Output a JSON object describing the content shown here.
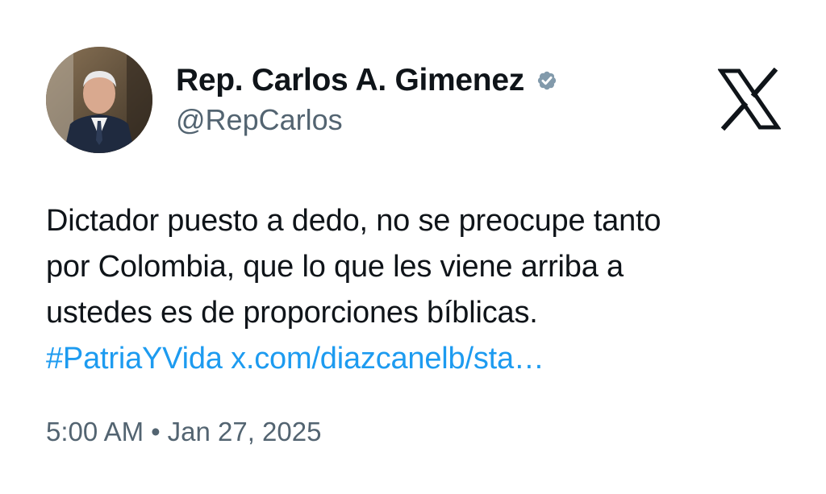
{
  "author": {
    "display_name": "Rep. Carlos A. Gimenez",
    "handle": "@RepCarlos",
    "verified_icon": "verified-badge-icon",
    "avatar": "profile-photo"
  },
  "brand": {
    "logo": "x-logo-icon"
  },
  "tweet": {
    "lines": [
      "Dictador puesto a dedo, no se preocupe tanto",
      "por Colombia, que lo que les viene arriba a",
      "ustedes es de proporciones bíblicas."
    ],
    "hashtag": "#PatriaYVida",
    "link": "x.com/diazcanelb/sta…"
  },
  "meta": {
    "time": "5:00 AM",
    "separator": "•",
    "date": "Jan 27, 2025"
  },
  "colors": {
    "text": "#0f1419",
    "secondary": "#536471",
    "link": "#1d9bf0",
    "verified_badge": "#829aab"
  }
}
